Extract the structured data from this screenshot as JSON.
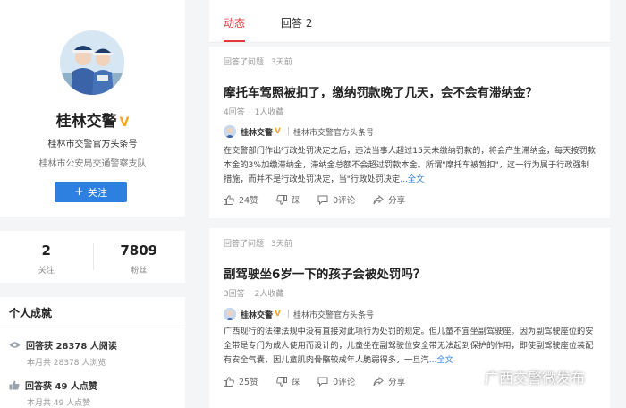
{
  "profile": {
    "name": "桂林交警",
    "verified_badge": "V",
    "title": "桂林市交警官方头条号",
    "org": "桂林市公安局交通警察支队",
    "follow_label": "关注",
    "follow_icon": "plus-icon"
  },
  "stats": [
    {
      "value": "2",
      "label": "关注"
    },
    {
      "value": "7809",
      "label": "粉丝"
    }
  ],
  "achievements": {
    "title": "个人成就",
    "items": [
      {
        "icon": "eye-icon",
        "main": "回答获 28378 人阅读",
        "sub": "本月共 28378 人浏览"
      },
      {
        "icon": "thumb-up-icon",
        "main": "回答获 49 人点赞",
        "sub": "本月共 49 人点赞"
      }
    ]
  },
  "tabs": [
    {
      "label": "动态",
      "active": true
    },
    {
      "label": "回答 2",
      "active": false
    }
  ],
  "feed": [
    {
      "action": "回答了问题",
      "time": "3天前",
      "question": "摩托车驾照被扣了，缴纳罚款晚了几天，会不会有滞纳金？",
      "answers": "4回答",
      "collects": "1人收藏",
      "answerer": {
        "name": "桂林交警",
        "badge": "V",
        "desc": "桂林市交警官方头条号"
      },
      "excerpt": "在交警部门作出行政处罚决定之后，违法当事人超过15天未缴纳罚款的，将会产生滞纳金，每天按罚款本金的3%加缴滞纳金，滞纳金总额不会超过罚款本金。所谓\"摩托车被暂扣\"，这一行为属于行政强制措施，而并不是行政处罚决定，当\"行政处罚决定",
      "more": "...全文",
      "likes": "24赞",
      "dislike": "踩",
      "comments": "0评论",
      "share": "分享"
    },
    {
      "action": "回答了问题",
      "time": "3天前",
      "question": "副驾驶坐6岁一下的孩子会被处罚吗？",
      "answers": "3回答",
      "collects": "2人收藏",
      "answerer": {
        "name": "桂林交警",
        "badge": "V",
        "desc": "桂林市交警官方头条号"
      },
      "excerpt": "广西现行的法律法规中没有直接对此项行为处罚的规定。但儿童不宜坐副驾驶座。因为副驾驶座位的安全带是专门为成人使用而设计的，儿童坐在副驾驶位安全带无法起到保护的作用，即使副驾驶座位装配有安全气囊，因儿童肌肉骨骼较成年人脆弱得多，一旦汽",
      "more": "...全文",
      "likes": "25赞",
      "dislike": "踩",
      "comments": "0评论",
      "share": "分享"
    }
  ],
  "watermark": "广西交警微发布",
  "colors": {
    "accent": "#e4393c",
    "link": "#2d7fe0",
    "badge": "#f5a623"
  }
}
